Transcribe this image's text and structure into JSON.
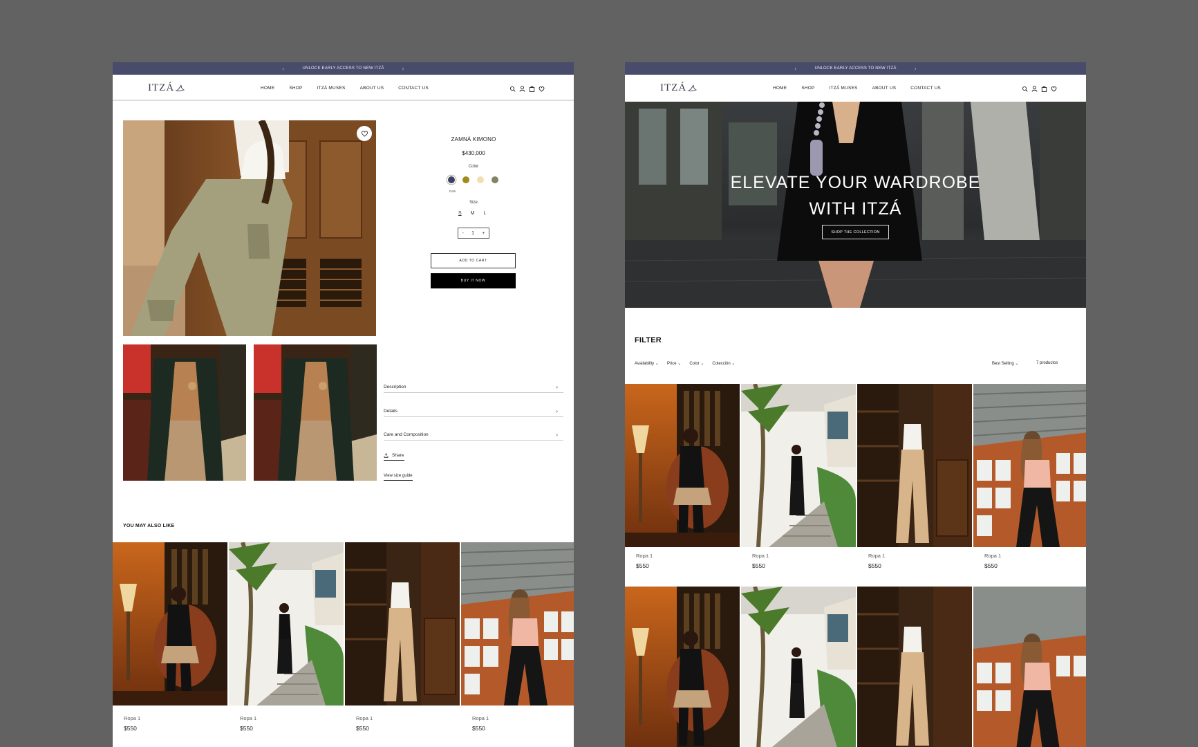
{
  "announcement": {
    "text": "UNLOCK EARLY ACCESS TO NEW ITZÁ",
    "prev": "‹",
    "next": "›"
  },
  "brand": {
    "logo_text": "ITZÁ",
    "accent": "#494b6b"
  },
  "nav": [
    "HOME",
    "SHOP",
    "ITZÁ MUSES",
    "ABOUT US",
    "CONTACT US"
  ],
  "header_icons": [
    "search-icon",
    "user-icon",
    "bag-icon",
    "heart-icon"
  ],
  "product": {
    "title": "ZAMNÁ KIMONO",
    "price": "$430,000",
    "color_label": "Color",
    "colors": [
      {
        "name": "search-swatch",
        "hex": "#3d4060"
      },
      {
        "name": "olive",
        "hex": "#a18b1c"
      },
      {
        "name": "cream",
        "hex": "#f3ddb3"
      },
      {
        "name": "sage",
        "hex": "#808565"
      }
    ],
    "selected_color_name": "Dark",
    "size_label": "Size",
    "sizes": [
      "S",
      "M",
      "L"
    ],
    "qty_minus": "-",
    "quantity": "1",
    "qty_plus": "+",
    "add_to_cart": "ADD TO CART",
    "buy_now": "BUY IT NOW",
    "accordion": [
      "Description",
      "Details",
      "Care and Composition"
    ],
    "share": "Share",
    "size_guide": "View size guide"
  },
  "also_like_title": "YOU MAY ALSO LIKE",
  "products": [
    {
      "name": "Ropa 1",
      "price": "$550"
    },
    {
      "name": "Ropa 1",
      "price": "$550"
    },
    {
      "name": "Ropa 1",
      "price": "$550"
    },
    {
      "name": "Ropa 1",
      "price": "$550"
    }
  ],
  "hero": {
    "title_line1": "ELEVATE YOUR WARDROBE",
    "title_line2": "WITH ITZÁ",
    "cta": "SHOP THE COLLECTION"
  },
  "shop": {
    "filter_title": "FILTER",
    "filters": [
      "Availability",
      "Price",
      "Color",
      "Colección"
    ],
    "sort": "Best Selling",
    "count": "7 productos"
  }
}
